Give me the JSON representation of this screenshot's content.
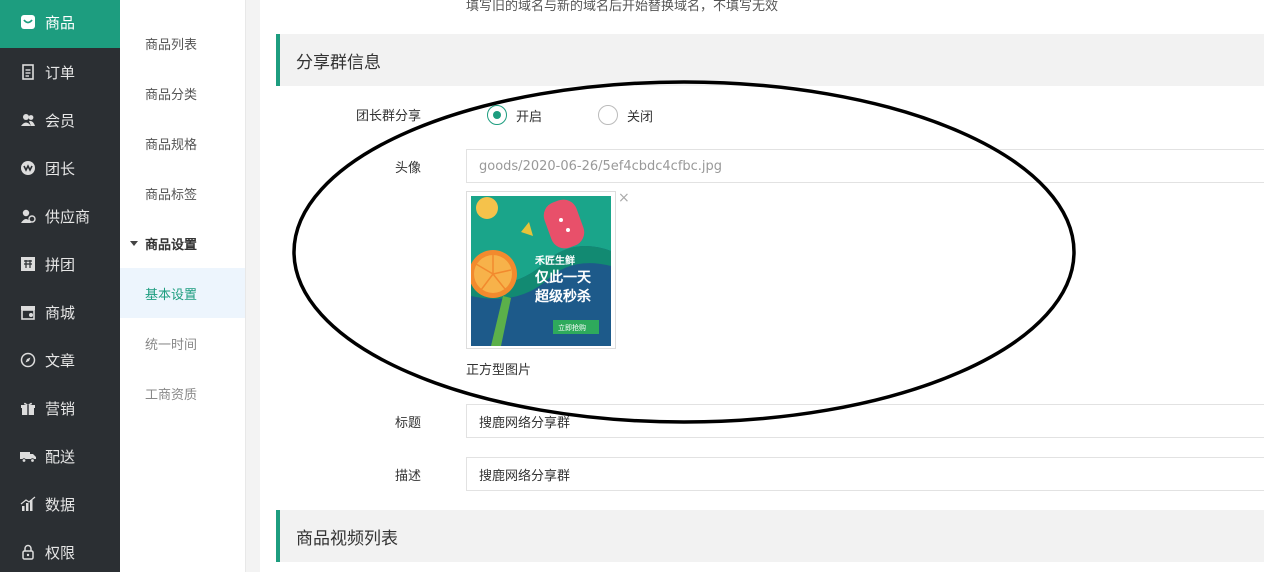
{
  "nav": [
    {
      "label": "商品",
      "icon": "goods-icon"
    },
    {
      "label": "订单",
      "icon": "order-icon"
    },
    {
      "label": "会员",
      "icon": "member-icon"
    },
    {
      "label": "团长",
      "icon": "leader-icon"
    },
    {
      "label": "供应商",
      "icon": "supplier-icon"
    },
    {
      "label": "拼团",
      "icon": "group-buy-icon"
    },
    {
      "label": "商城",
      "icon": "mall-icon"
    },
    {
      "label": "文章",
      "icon": "article-icon"
    },
    {
      "label": "营销",
      "icon": "gift-icon"
    },
    {
      "label": "配送",
      "icon": "truck-icon"
    },
    {
      "label": "数据",
      "icon": "chart-icon"
    },
    {
      "label": "权限",
      "icon": "lock-icon"
    }
  ],
  "submenu": [
    {
      "label": "商品列表"
    },
    {
      "label": "商品分类"
    },
    {
      "label": "商品规格"
    },
    {
      "label": "商品标签"
    },
    {
      "label": "商品设置"
    },
    {
      "label": "基本设置"
    },
    {
      "label": "统一时间"
    },
    {
      "label": "工商资质"
    }
  ],
  "main": {
    "top_hint": "填写旧的域名与新的域名后开始替换域名，不填写无效",
    "share_section": {
      "title": "分享群信息",
      "share_label": "团长群分享",
      "radio_on": "开启",
      "radio_off": "关闭",
      "avatar_label": "头像",
      "avatar_path": "goods/2020-06-26/5ef4cbdc4cfbc.jpg",
      "image_caption": "正方型图片",
      "promo_brand": "禾匠生鲜",
      "promo_line1": "仅此一天",
      "promo_line2": "超级秒杀",
      "promo_button": "立即抢购",
      "close_symbol": "×",
      "title_label": "标题",
      "title_value": "搜鹿网络分享群",
      "desc_label": "描述",
      "desc_value": "搜鹿网络分享群"
    },
    "video_section": {
      "title": "商品视频列表"
    }
  },
  "colors": {
    "accent": "#1d9d7f",
    "nav_bg": "#2b2f33",
    "promo_bg": "#1d5a8a"
  }
}
